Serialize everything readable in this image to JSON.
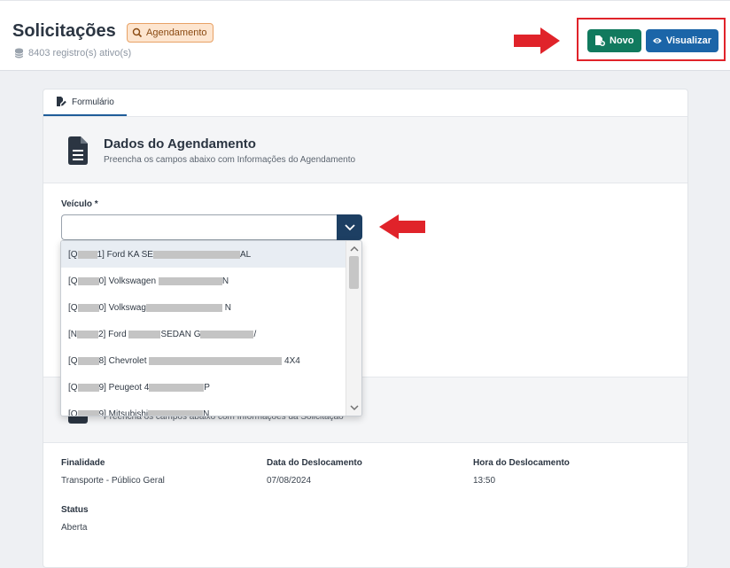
{
  "header": {
    "title": "Solicitações",
    "badge": "Agendamento",
    "record_count": "8403 registro(s) ativo(s)",
    "btn_new": "Novo",
    "btn_view": "Visualizar"
  },
  "tabs": [
    {
      "label": "Formulário"
    }
  ],
  "section1": {
    "title": "Dados do Agendamento",
    "subtitle": "Preencha os campos abaixo com Informações do Agendamento",
    "field_label": "Veículo *",
    "field_value": ""
  },
  "dropdown": {
    "options": [
      {
        "a": "[Q",
        "b": "1] Ford KA SE",
        "c": "AL"
      },
      {
        "a": "[Q",
        "b": "0] Volkswagen",
        "c": "N"
      },
      {
        "a": "[Q",
        "b": "0] Volkswag",
        "c": "N"
      },
      {
        "a": "[N",
        "b": "2] Ford",
        "c": "SEDAN G",
        "d": "/"
      },
      {
        "a": "[Q",
        "b": "8] Chevrolet",
        "c": "4X4"
      },
      {
        "a": "[Q",
        "b": "9] Peugeot 4",
        "c": "P"
      },
      {
        "a": "[Q",
        "b": "9] Mitsubishi",
        "c": "N"
      }
    ]
  },
  "section2": {
    "subtitle": "Preencha os campos abaixo com Informações da Solicitação"
  },
  "info": {
    "finalidade_label": "Finalidade",
    "finalidade_value": "Transporte - Público Geral",
    "data_label": "Data do Deslocamento",
    "data_value": "07/08/2024",
    "hora_label": "Hora do Deslocamento",
    "hora_value": "13:50",
    "status_label": "Status",
    "status_value": "Aberta"
  },
  "colors": {
    "primary_dark": "#1d3f63",
    "success": "#117a5e",
    "info": "#1b65a8",
    "annotation_red": "#e0232a",
    "badge_bg": "#fde5cf"
  }
}
